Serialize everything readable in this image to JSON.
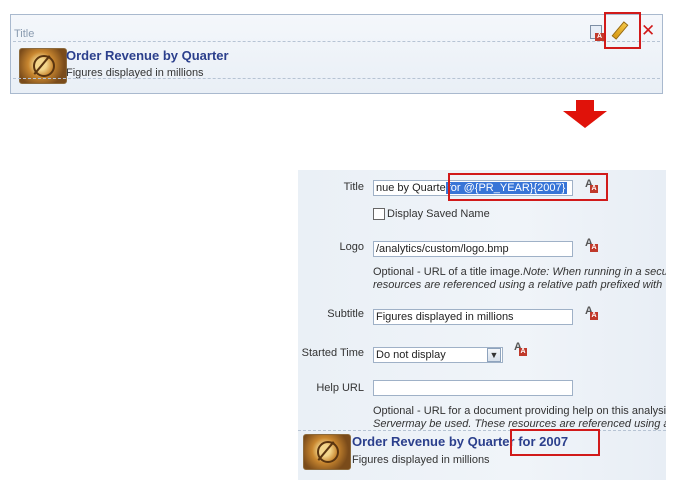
{
  "top_panel": {
    "label": "Title",
    "report_title": "Order Revenue by Quarter",
    "subtitle": "Figures displayed in millions",
    "icons": [
      "format-icon",
      "edit-pencil-icon",
      "delete-icon"
    ]
  },
  "colors": {
    "accent_red": "#d11a1a",
    "title_blue": "#2b3f8c",
    "highlight": "#3875d7"
  },
  "editor": {
    "title": {
      "label": "Title",
      "value_plain": "nue by Quarte",
      "value_highlight": "for @{PR_YEAR}{2007}"
    },
    "display_saved_name": "Display Saved Name",
    "logo": {
      "label": "Logo",
      "value": "/analytics/custom/logo.bmp",
      "help_prefix": "Optional - URL of a title image.",
      "help_note": "Note: When running in a secur",
      "help_line2": "resources are referenced using a relative path prefixed with"
    },
    "subtitle": {
      "label": "Subtitle",
      "value": "Figures displayed in millions"
    },
    "started_time": {
      "label": "Started Time",
      "selected": "Do not display"
    },
    "help_url": {
      "label": "Help URL",
      "value": "",
      "help_line1": "Optional - URL for a document providing help on this analysis",
      "help_line2": "Servermay be used. These resources are referenced using a"
    },
    "preview": {
      "title": "Order Revenue by Quarter",
      "title_suffix": "for 2007",
      "subtitle": "Figures displayed in millions"
    }
  }
}
